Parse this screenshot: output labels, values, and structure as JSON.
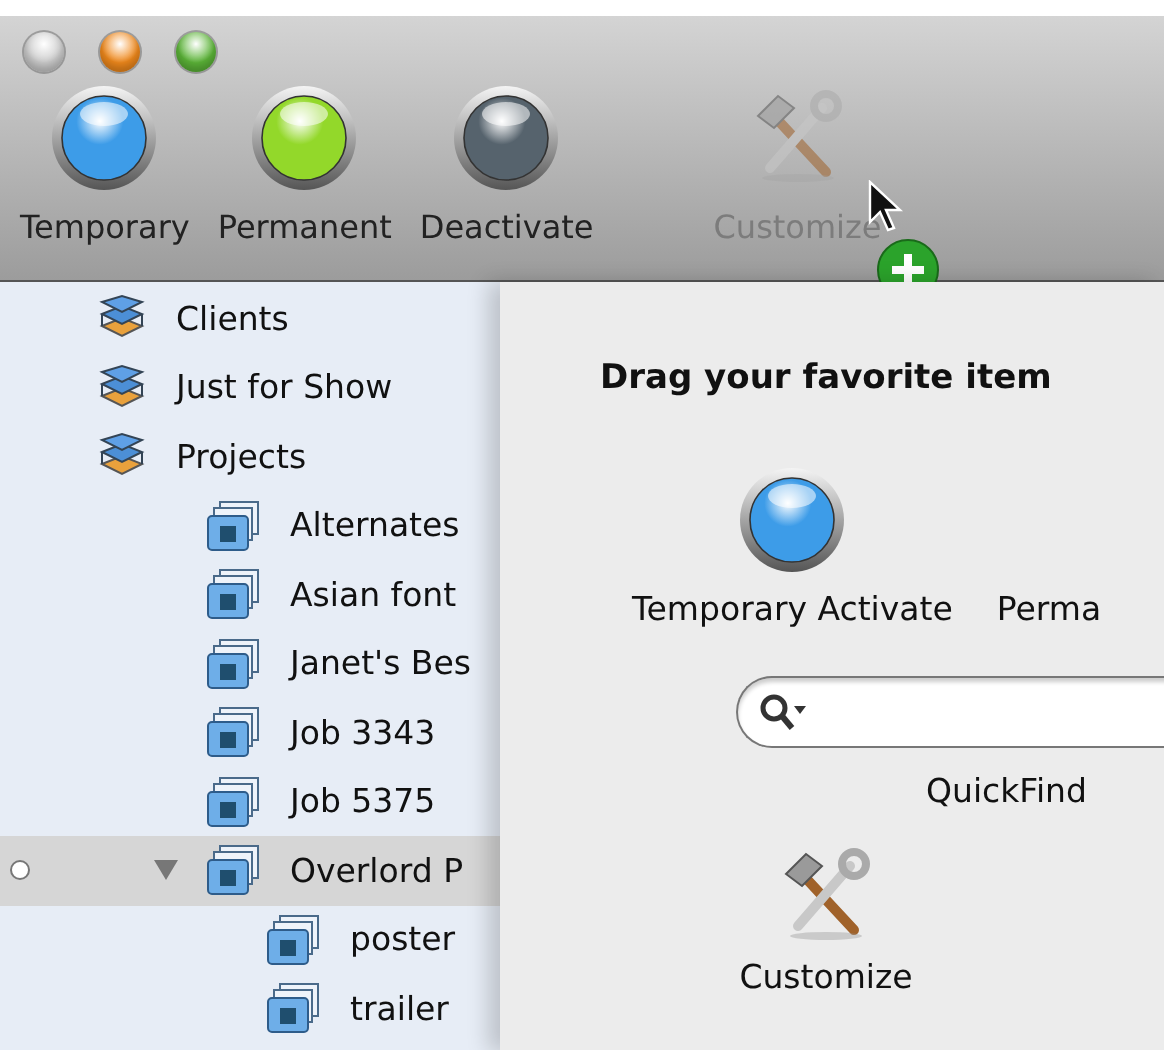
{
  "window": {
    "buttons": [
      {
        "color": "#cdcdcd"
      },
      {
        "color": "#f0891c"
      },
      {
        "color": "#5cb538"
      }
    ]
  },
  "toolbar": {
    "items": [
      {
        "kind": "orb",
        "label": "Temporary",
        "color": "#3d9ce8",
        "disabled": false
      },
      {
        "kind": "orb",
        "label": "Permanent",
        "color": "#93d82a",
        "disabled": false
      },
      {
        "kind": "orb",
        "label": "Deactivate",
        "color": "#56636d",
        "disabled": false
      },
      {
        "kind": "tools",
        "label": "Customize",
        "disabled": true
      }
    ]
  },
  "sidebar": {
    "items": [
      {
        "label": "Clients",
        "kind": "library",
        "selected": false
      },
      {
        "label": "Just for Show",
        "kind": "library",
        "selected": false
      },
      {
        "label": "Projects",
        "kind": "library",
        "selected": false,
        "children": [
          {
            "label": "Alternates",
            "kind": "set",
            "selected": false
          },
          {
            "label": "Asian font",
            "kind": "set",
            "selected": false
          },
          {
            "label": "Janet's Bes",
            "kind": "set",
            "selected": false
          },
          {
            "label": "Job 3343",
            "kind": "set",
            "selected": false
          },
          {
            "label": "Job 5375",
            "kind": "set",
            "selected": false
          },
          {
            "label": "Overlord P",
            "kind": "set",
            "selected": true,
            "expanded": true,
            "children": [
              {
                "label": "poster",
                "kind": "set",
                "selected": false
              },
              {
                "label": "trailer",
                "kind": "set",
                "selected": false
              }
            ]
          }
        ]
      }
    ]
  },
  "sheet": {
    "title": "Drag your favorite item",
    "items": [
      {
        "kind": "orb",
        "label": "Temporary Activate",
        "color": "#3d9ce8"
      },
      {
        "kind": "text",
        "label": "Perma"
      },
      {
        "kind": "search",
        "label": "QuickFind"
      },
      {
        "kind": "tools",
        "label": "Customize"
      }
    ]
  }
}
